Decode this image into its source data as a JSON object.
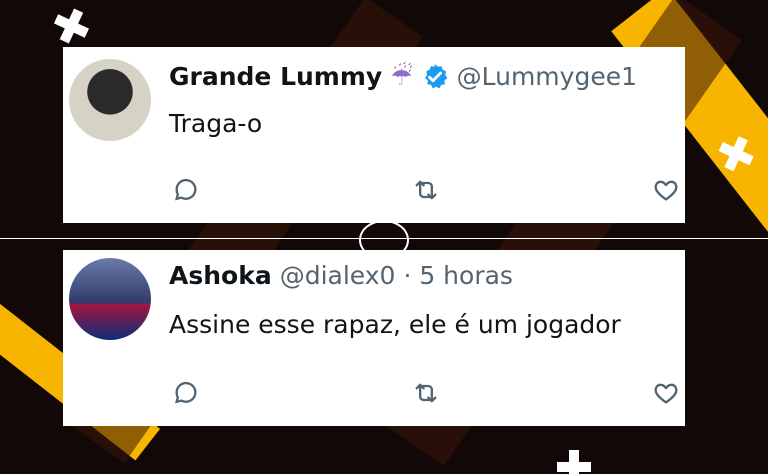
{
  "colors": {
    "background": "#120808",
    "accent": "#f7b500",
    "verified": "#1d9bf0",
    "text": "#0f1419",
    "muted": "#536471"
  },
  "posts": [
    {
      "display_name": "Grande Lummy",
      "emoji": "☔",
      "handle": "@Lummygee1",
      "text": "Traga-o",
      "verified": true
    },
    {
      "display_name": "Ashoka",
      "handle": "@dialex0",
      "meta": "· 5 horas",
      "text": "Assine esse rapaz, ele é um jogador"
    }
  ],
  "icons": {
    "reply": "reply-icon",
    "retweet": "retweet-icon",
    "like": "heart-icon"
  }
}
